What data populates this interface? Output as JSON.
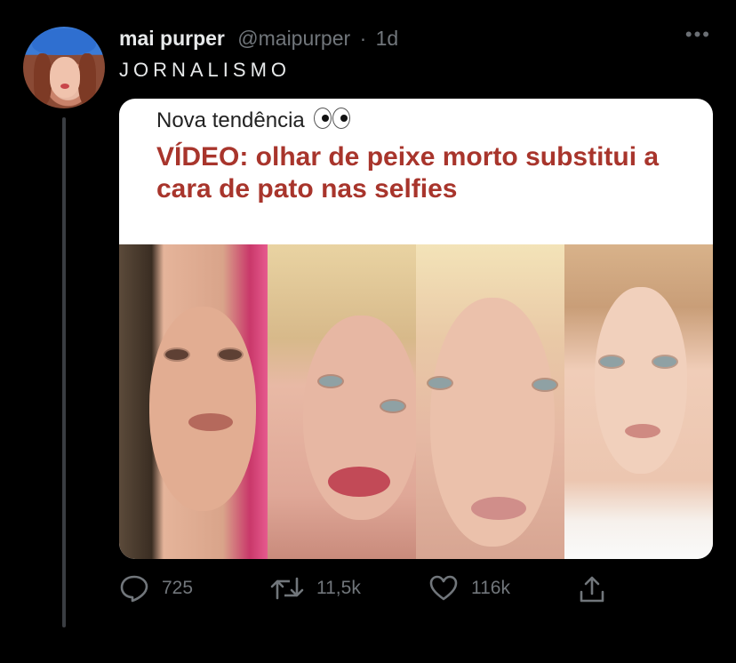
{
  "tweet": {
    "author_name": "mai purper",
    "author_handle": "@maipurper",
    "separator": "·",
    "time": "1d",
    "text": "JORNALISMO"
  },
  "card": {
    "kicker": "Nova tendência",
    "kicker_emoji": "eyes-icon",
    "headline": "VÍDEO: olhar de peixe morto substitui a cara de pato nas selfies"
  },
  "actions": {
    "replies": "725",
    "retweets": "11,5k",
    "likes": "116k"
  },
  "colors": {
    "background": "#000000",
    "headline": "#a8352c",
    "muted": "#71767b"
  }
}
